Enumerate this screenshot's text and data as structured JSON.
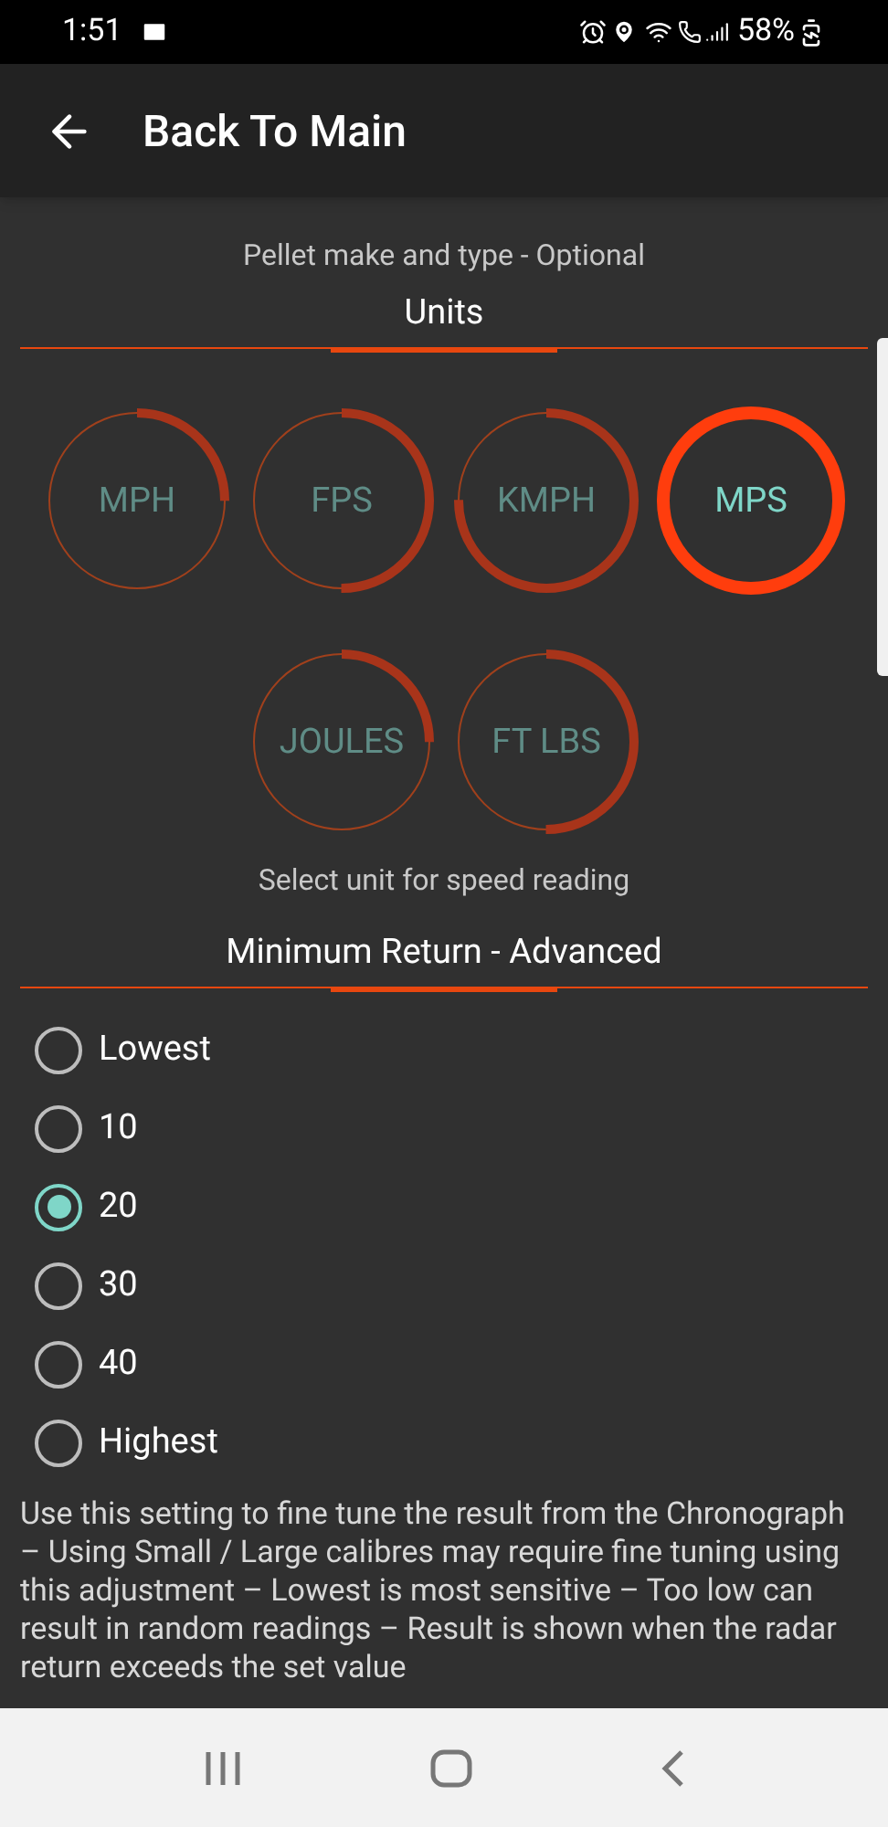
{
  "status_bar": {
    "time": "1:51",
    "battery": "58%"
  },
  "app_bar": {
    "title": "Back To Main"
  },
  "pellet_caption": "Pellet make and type - Optional",
  "units": {
    "heading": "Units",
    "options": [
      {
        "label": "MPH",
        "selected": false
      },
      {
        "label": "FPS",
        "selected": false
      },
      {
        "label": "KMPH",
        "selected": false
      },
      {
        "label": "MPS",
        "selected": true
      },
      {
        "label": "JOULES",
        "selected": false
      },
      {
        "label": "FT LBS",
        "selected": false
      }
    ],
    "caption": "Select unit for speed reading"
  },
  "minimum_return": {
    "heading": "Minimum Return - Advanced",
    "options": [
      {
        "label": "Lowest",
        "selected": false
      },
      {
        "label": "10",
        "selected": false
      },
      {
        "label": "20",
        "selected": true
      },
      {
        "label": "30",
        "selected": false
      },
      {
        "label": "40",
        "selected": false
      },
      {
        "label": "Highest",
        "selected": false
      }
    ],
    "description": "Use this setting to fine tune the result from the Chronograph – Using Small / Large calibres may require fine tuning using this adjustment – Lowest is most sensitive – Too low can result in random readings – Result is shown when the radar return exceeds the set value"
  }
}
